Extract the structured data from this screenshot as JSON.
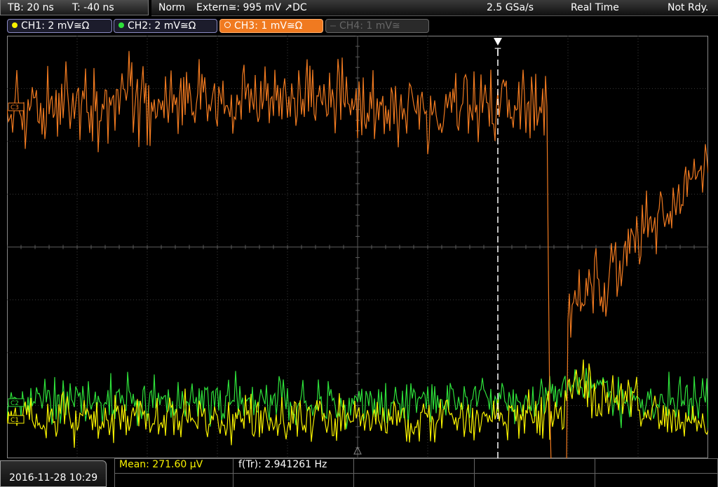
{
  "timebase": {
    "tb": "TB: 20 ns",
    "trigger_time": "T: -40 ns"
  },
  "status": {
    "mode": "Norm",
    "trigger_source": "Extern≅: 995 mV ↗DC",
    "sample_rate": "2.5 GSa/s",
    "acq_mode": "Real Time",
    "state": "Not Rdy."
  },
  "channels": [
    {
      "label": "CH1: 2 mV≅Ω",
      "color": "#f8f200",
      "active": true
    },
    {
      "label": "CH2: 2 mV≅Ω",
      "color": "#2ee03a",
      "active": true
    },
    {
      "label": "CH3: 1 mV≅Ω",
      "color": "#f07a20",
      "active": true,
      "selected": true
    },
    {
      "label": "CH4: 1 mV≅",
      "color": "#666666",
      "active": false
    }
  ],
  "markers": {
    "ch3": "C3",
    "ch2": "C2",
    "ch1": "C1",
    "trigger": "T"
  },
  "colors": {
    "grid": "#3c3c3c",
    "grid_center": "#5a5a5a",
    "ch1": "#f8f200",
    "ch2": "#2ee03a",
    "ch3": "#f07a20",
    "trigger": "#ffffff"
  },
  "datetime": "2016-11-28 10:29",
  "measurements": {
    "mean": "Mean: 271.60 µV",
    "freq": "f(Tr): 2.941261 Hz"
  }
}
